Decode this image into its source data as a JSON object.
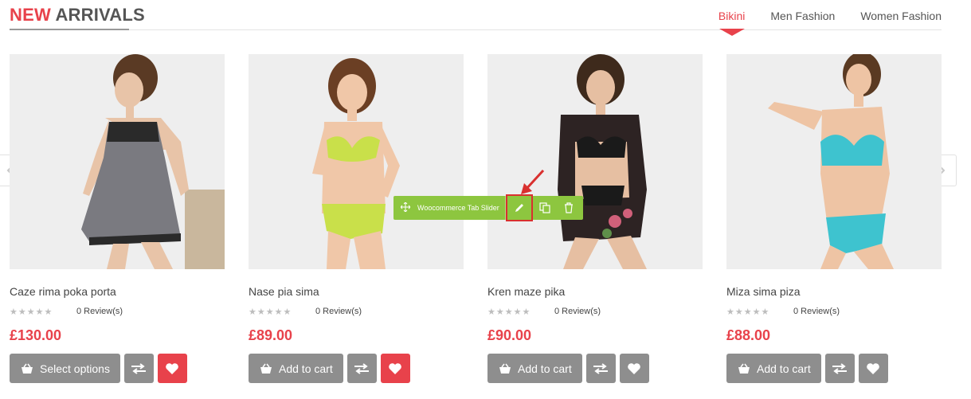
{
  "header": {
    "title_accent": "NEW",
    "title_rest": "ARRIVALS",
    "tabs": [
      "Bikini",
      "Men Fashion",
      "Women Fashion"
    ],
    "active_tab": "Bikini"
  },
  "products": [
    {
      "name": "Caze rima poka porta",
      "reviews": "0 Review(s)",
      "price": "£130.00",
      "cart_label": "Select options",
      "wishlist_active": true
    },
    {
      "name": "Nase pia sima",
      "reviews": "0 Review(s)",
      "price": "£89.00",
      "cart_label": "Add to cart",
      "wishlist_active": true
    },
    {
      "name": "Kren maze pika",
      "reviews": "0 Review(s)",
      "price": "£90.00",
      "cart_label": "Add to cart",
      "wishlist_active": false
    },
    {
      "name": "Miza sima piza",
      "reviews": "0 Review(s)",
      "price": "£88.00",
      "cart_label": "Add to cart",
      "wishlist_active": false
    }
  ],
  "toolbar": {
    "label": "Woocommerce Tab Slider"
  },
  "colors": {
    "accent": "#e8424b",
    "button_gray": "#8e8e8e",
    "toolbar_green": "#8dc63f"
  },
  "icons": {
    "cart": "basket-icon",
    "compare": "compare-arrows-icon",
    "wishlist": "heart-icon",
    "move": "move-icon",
    "edit": "pencil-icon",
    "duplicate": "duplicate-icon",
    "delete": "trash-icon"
  }
}
